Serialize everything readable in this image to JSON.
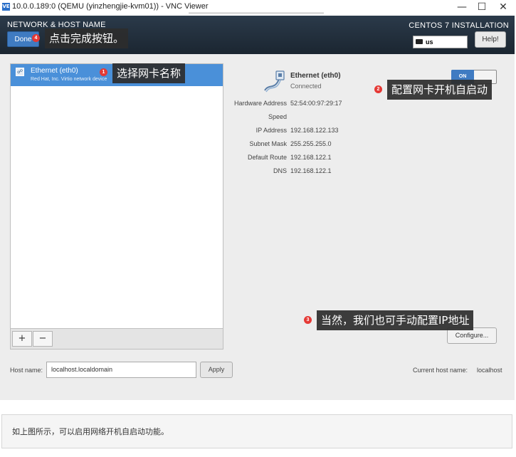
{
  "window": {
    "title": "10.0.0.189:0 (QEMU (yinzhengjie-kvm01)) - VNC Viewer",
    "logo_text": "VE",
    "minimize_glyph": "—",
    "maximize_glyph": "☐",
    "close_glyph": "✕"
  },
  "header": {
    "title": "NETWORK & HOST NAME",
    "done_label": "Done",
    "product_title": "CENTOS 7 INSTALLATION",
    "keyboard_layout": "us",
    "help_label": "Help!"
  },
  "nic_list": {
    "items": [
      {
        "name": "Ethernet (eth0)",
        "description": "Red Hat, Inc. Virtio network device",
        "selected": true
      }
    ],
    "add_label": "+",
    "remove_label": "−"
  },
  "device": {
    "name": "Ethernet (eth0)",
    "status": "Connected",
    "toggle_label": "ON",
    "toggle_state": true,
    "details": [
      {
        "label": "Hardware Address",
        "value": "52:54:00:97:29:17"
      },
      {
        "label": "Speed",
        "value": ""
      },
      {
        "label": "IP Address",
        "value": "192.168.122.133"
      },
      {
        "label": "Subnet Mask",
        "value": "255.255.255.0"
      },
      {
        "label": "Default Route",
        "value": "192.168.122.1"
      },
      {
        "label": "DNS",
        "value": "192.168.122.1"
      }
    ],
    "configure_label": "Configure..."
  },
  "hostname": {
    "label": "Host name:",
    "value": "localhost.localdomain",
    "apply_label": "Apply",
    "current_label": "Current host name:",
    "current_value": "localhost"
  },
  "annotations": [
    {
      "number": "1",
      "text": "选择网卡名称"
    },
    {
      "number": "2",
      "text": "配置网卡开机自启动"
    },
    {
      "number": "3",
      "text": "当然，我们也可手动配置IP地址"
    },
    {
      "number": "4",
      "text": "点击完成按钮。"
    }
  ],
  "caption": "如上图所示，可以启用网络开机自启动功能。",
  "colors": {
    "header_bg": "#1b2631",
    "accent_blue": "#3f7bc2",
    "selected_row": "#4a90d9",
    "badge_red": "#e53935"
  }
}
